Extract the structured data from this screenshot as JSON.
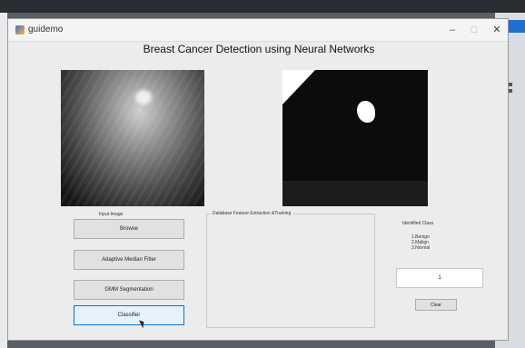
{
  "window": {
    "title": "guidemo",
    "min_glyph": "–",
    "max_glyph": "□",
    "close_glyph": "✕"
  },
  "heading": "Breast Cancer Detection using Neural Networks",
  "images": {
    "input_label": "Input Image"
  },
  "buttons": {
    "browse": "Browse",
    "median": "Adaptive Median Filter",
    "gmm": "GMM Segmentation",
    "classify": "Classifier"
  },
  "panel": {
    "title": "Database Feature Extraction &Training"
  },
  "classes": {
    "title": "Identified Class",
    "items": [
      "1.Benign",
      "2.Malign",
      "3.Normal"
    ]
  },
  "result": {
    "value": "1"
  },
  "clear_label": "Clear",
  "colors": {
    "accent": "#0078d7",
    "window_bg": "#ececec"
  }
}
